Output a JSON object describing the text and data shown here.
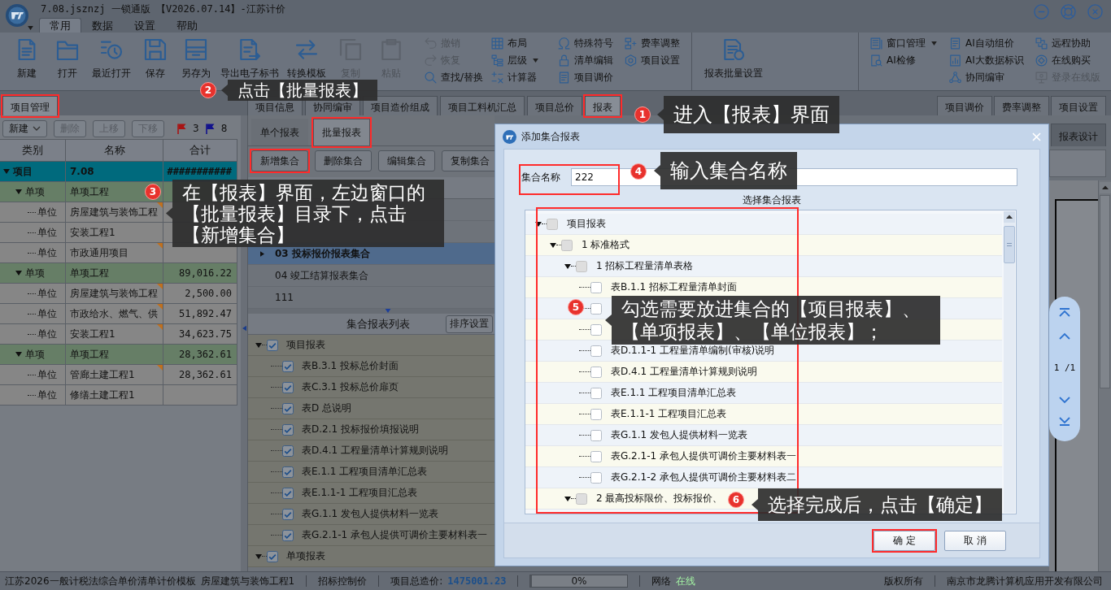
{
  "window": {
    "title": "7.08.jsznzj 一锁通版 【V2026.07.14】-江苏计价"
  },
  "menu_tabs": [
    {
      "label": "常用",
      "selected": true
    },
    {
      "label": "数据",
      "selected": false
    },
    {
      "label": "设置",
      "selected": false
    },
    {
      "label": "帮助",
      "selected": false
    }
  ],
  "ribbon": [
    {
      "large": [
        {
          "label": "新建",
          "disabled": false
        },
        {
          "label": "打开",
          "disabled": false
        },
        {
          "label": "最近打开",
          "disabled": false
        },
        {
          "label": "保存",
          "disabled": false
        },
        {
          "label": "另存为",
          "disabled": false
        },
        {
          "label": "导出电子标书",
          "disabled": false
        },
        {
          "label": "转换模板",
          "disabled": false
        },
        {
          "label": "复制",
          "disabled": true
        },
        {
          "label": "粘贴",
          "disabled": true
        }
      ],
      "columns": [
        [
          {
            "label": "撤销",
            "disabled": true,
            "dropdown": false
          },
          {
            "label": "恢复",
            "disabled": true,
            "dropdown": false
          },
          {
            "label": "查找/替换",
            "disabled": false,
            "dropdown": false
          }
        ],
        [
          {
            "label": "布局",
            "disabled": false,
            "dropdown": false
          },
          {
            "label": "层级",
            "disabled": false,
            "dropdown": true
          },
          {
            "label": "计算器",
            "disabled": false,
            "dropdown": false
          }
        ],
        [
          {
            "label": "特殊符号",
            "disabled": false,
            "dropdown": false
          },
          {
            "label": "清单编辑",
            "disabled": false,
            "dropdown": false
          },
          {
            "label": "项目调价",
            "disabled": false,
            "dropdown": false
          }
        ],
        [
          {
            "label": "费率调整",
            "disabled": false,
            "dropdown": false
          },
          {
            "label": "项目设置",
            "disabled": false,
            "dropdown": false
          }
        ]
      ]
    },
    {
      "large": [
        {
          "label": "报表批量设置",
          "disabled": false
        }
      ]
    },
    {
      "columns": [
        [
          {
            "label": "窗口管理",
            "disabled": false,
            "dropdown": true
          },
          {
            "label": "AI检修",
            "disabled": false,
            "dropdown": false
          }
        ],
        [
          {
            "label": "AI自动组价",
            "disabled": false,
            "dropdown": false
          },
          {
            "label": "AI大数据标识",
            "disabled": false,
            "dropdown": false
          },
          {
            "label": "协同编审",
            "disabled": false,
            "dropdown": false
          }
        ],
        [
          {
            "label": "远程协助",
            "disabled": false,
            "dropdown": false
          },
          {
            "label": "在线购买",
            "disabled": false,
            "dropdown": false
          },
          {
            "label": "登录在线版",
            "disabled": true,
            "dropdown": false
          }
        ]
      ]
    }
  ],
  "tab_bar": {
    "left": [
      {
        "label": "项目管理",
        "selected": true,
        "highlighted": true
      }
    ],
    "middle": [
      {
        "label": "项目信息",
        "selected": false,
        "highlighted": false
      },
      {
        "label": "协同编审",
        "selected": false,
        "highlighted": false
      },
      {
        "label": "项目造价组成",
        "selected": false,
        "highlighted": false
      },
      {
        "label": "项目工料机汇总",
        "selected": false,
        "highlighted": false
      },
      {
        "label": "项目总价",
        "selected": false,
        "highlighted": false
      },
      {
        "label": "报表",
        "selected": true,
        "highlighted": true
      }
    ],
    "right": [
      {
        "label": "项目调价",
        "selected": false,
        "highlighted": false
      },
      {
        "label": "费率调整",
        "selected": false,
        "highlighted": false
      },
      {
        "label": "项目设置",
        "selected": false,
        "highlighted": false
      }
    ]
  },
  "project_panel": {
    "toolbar": [
      {
        "label": "新建",
        "disabled": false,
        "dropdown": true
      },
      {
        "label": "删除",
        "disabled": true,
        "dropdown": false
      },
      {
        "label": "上移",
        "disabled": true,
        "dropdown": false
      },
      {
        "label": "下移",
        "disabled": true,
        "dropdown": false
      }
    ],
    "flags": [
      {
        "count": "3",
        "color": "#a81414"
      },
      {
        "count": "8",
        "color": "#12128c"
      }
    ],
    "columns": [
      "类别",
      "名称",
      "合计"
    ],
    "rows": [
      {
        "category": "项目",
        "name": "7.08",
        "total": "###########",
        "selected": true,
        "expanded": true,
        "corner_mark": false,
        "children": [
          {
            "category": "单项",
            "name": "单项工程",
            "selected": false,
            "expanded": true,
            "corner_mark": false,
            "children": [
              {
                "category": "单位",
                "name": "房屋建筑与装饰工程",
                "selected": false,
                "corner_mark": true
              },
              {
                "category": "单位",
                "name": "安装工程1",
                "selected": false,
                "corner_mark": false
              },
              {
                "category": "单位",
                "name": "市政通用项目",
                "selected": false,
                "corner_mark": true
              }
            ]
          },
          {
            "category": "单项",
            "name": "单项工程",
            "total": "89,016.22",
            "selected": false,
            "expanded": true,
            "corner_mark": false,
            "children": [
              {
                "category": "单位",
                "name": "房屋建筑与装饰工程",
                "total": "2,500.00",
                "selected": false,
                "corner_mark": true
              },
              {
                "category": "单位",
                "name": "市政给水、燃气、供",
                "total": "51,892.47",
                "selected": false,
                "corner_mark": true
              },
              {
                "category": "单位",
                "name": "安装工程1",
                "total": "34,623.75",
                "selected": false,
                "corner_mark": true
              }
            ]
          },
          {
            "category": "单项",
            "name": "单项工程",
            "total": "28,362.61",
            "selected": false,
            "expanded": true,
            "corner_mark": false,
            "children": [
              {
                "category": "单位",
                "name": "管廊土建工程1",
                "total": "28,362.61",
                "selected": false,
                "corner_mark": true
              },
              {
                "category": "单位",
                "name": "修缮土建工程1",
                "selected": false,
                "corner_mark": false
              }
            ]
          }
        ]
      }
    ]
  },
  "report_panel": {
    "tabs": [
      {
        "label": "单个报表",
        "selected": false,
        "highlighted": false
      },
      {
        "label": "批量报表",
        "selected": true,
        "highlighted": true
      }
    ],
    "buttons": [
      {
        "label": "新增集合",
        "highlighted": true
      },
      {
        "label": "删除集合",
        "highlighted": false
      },
      {
        "label": "编辑集合",
        "highlighted": false
      },
      {
        "label": "复制集合",
        "highlighted": false
      }
    ],
    "sets": [
      {
        "selected": false
      },
      {
        "selected": false
      },
      {
        "label": "03 投标报价报表集合",
        "selected": true
      },
      {
        "label": "04 竣工结算报表集合",
        "selected": false
      },
      {
        "label": "111",
        "selected": false
      }
    ],
    "list_title": "集合报表列表",
    "sort_button": "排序设置",
    "tree": [
      {
        "label": "项目报表",
        "checked": true,
        "expanded": true,
        "children": [
          {
            "label": "表B.3.1 投标总价封面",
            "checked": true
          },
          {
            "label": "表C.3.1 投标总价扉页",
            "checked": true
          },
          {
            "label": "表D 总说明",
            "checked": true
          },
          {
            "label": "表D.2.1 投标报价填报说明",
            "checked": true
          },
          {
            "label": "表D.4.1 工程量清单计算规则说明",
            "checked": true
          },
          {
            "label": "表E.1.1 工程项目清单汇总表",
            "checked": true
          },
          {
            "label": "表E.1.1-1 工程项目汇总表",
            "checked": true
          },
          {
            "label": "表G.1.1 发包人提供材料一览表",
            "checked": true
          },
          {
            "label": "表G.2.1-1 承包人提供可调价主要材料表一",
            "checked": true
          }
        ]
      },
      {
        "label": "单项报表",
        "checked": true,
        "expanded": true
      }
    ]
  },
  "right_panel": {
    "tab": {
      "label": "报表设计",
      "selected": true
    },
    "page_nav": {
      "page": "1 /1"
    }
  },
  "dialog": {
    "title": "添加集合报表",
    "name_label": "集合名称",
    "name_value": "222",
    "name_highlighted": true,
    "tree_title": "选择集合报表",
    "tree_highlighted": true,
    "tree": [
      {
        "label": "项目报表",
        "checked": false,
        "expanded": true,
        "children": [
          {
            "label": "1 标准格式",
            "checked": false,
            "expanded": true,
            "children": [
              {
                "label": "1 招标工程量清单表格",
                "checked": false,
                "expanded": true,
                "children": [
                  {
                    "label": "表B.1.1 招标工程量清单封面",
                    "checked": false
                  },
                  {
                    "checked": false
                  },
                  {
                    "checked": false
                  },
                  {
                    "label": "表D.1.1-1 工程量清单编制(审核)说明",
                    "checked": false
                  },
                  {
                    "label": "表D.4.1 工程量清单计算规则说明",
                    "checked": false
                  },
                  {
                    "label": "表E.1.1 工程项目清单汇总表",
                    "checked": false
                  },
                  {
                    "label": "表E.1.1-1 工程项目汇总表",
                    "checked": false
                  },
                  {
                    "label": "表G.1.1 发包人提供材料一览表",
                    "checked": false
                  },
                  {
                    "label": "表G.2.1-1 承包人提供可调价主要材料表一",
                    "checked": false
                  },
                  {
                    "label": "表G.2.1-2 承包人提供可调价主要材料表二",
                    "checked": false
                  }
                ]
              },
              {
                "label": "2 最高投标限价、投标报价、",
                "checked": false,
                "expanded": true
              }
            ]
          }
        ]
      }
    ],
    "buttons": [
      {
        "label": "确 定",
        "highlighted": true
      },
      {
        "label": "取 消",
        "highlighted": false
      }
    ]
  },
  "status_bar": {
    "template": "江苏2026一般计税法综合单价清单计价模板",
    "unit": "房屋建筑与装饰工程1",
    "price_type": "招标控制价",
    "total_label": "项目总造价:",
    "total_value": "1475001.23",
    "progress": {
      "level": 0,
      "text": "0%"
    },
    "network_label": "网络",
    "network_status": "在线",
    "online": true,
    "copyright": "版权所有",
    "company": "南京市龙腾计算机应用开发有限公司"
  },
  "annotations": [
    {
      "step": "1",
      "text": "进入【报表】界面"
    },
    {
      "step": "2",
      "text": "点击【批量报表】"
    },
    {
      "step": "3",
      "text": "在【报表】界面，左边窗口的【批量报表】目录下，点击【新增集合】"
    },
    {
      "step": "4",
      "text": "输入集合名称"
    },
    {
      "step": "5",
      "text": "勾选需要放进集合的【项目报表】、【单项报表】、【单位报表】；"
    },
    {
      "step": "6",
      "text": "选择完成后，点击【确定】"
    }
  ]
}
